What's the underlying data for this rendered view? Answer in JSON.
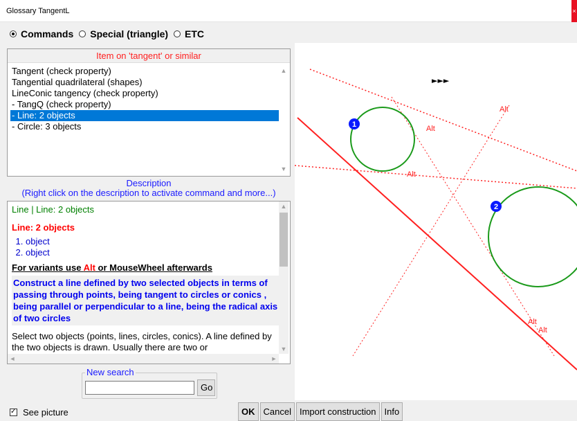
{
  "window": {
    "title": "Glossary  TangentL",
    "close_glyph": "×"
  },
  "modes": [
    {
      "label": "Commands",
      "checked": true
    },
    {
      "label": "Special (triangle)",
      "checked": false
    },
    {
      "label": "ETC",
      "checked": false
    }
  ],
  "items": {
    "header": "Item on 'tangent' or similar",
    "list": [
      "Tangent  (check property)",
      "Tangential quadrilateral  (shapes)",
      "LineConic tangency  (check property)",
      "- TangQ  (check property)",
      "- Line: 2 objects",
      "- Circle: 3 objects"
    ],
    "selected_index": 4
  },
  "description": {
    "header_line1": "Description",
    "header_line2": "(Right click on the description to activate command and more...)",
    "breadcrumb": "Line | Line: 2 objects",
    "title": "Line: 2 objects",
    "params": [
      "object",
      "object"
    ],
    "variants_prefix": "For variants use ",
    "variants_alt": "Alt",
    "variants_suffix": " or MouseWheel afterwards",
    "summary": "Construct a line defined by two selected objects in terms of passing through points, being tangent to circles or conics , being parallel or perpendicular to a line, being the radical axis of two circles",
    "detail": "Select two objects (points, lines, circles, conics). A line defined by the two objects is drawn. Usually there are two or"
  },
  "search": {
    "legend": "New search",
    "value": "",
    "go_label": "Go"
  },
  "footer": {
    "see_picture_label": "See picture",
    "see_picture_checked": true,
    "buttons": [
      "OK",
      "Cancel",
      "Import construction",
      "Info"
    ]
  },
  "picture": {
    "arrows": "►►►",
    "label_1": "1",
    "label_2": "2",
    "alt_label": "Alt",
    "colors": {
      "circle": "#1a9a1a",
      "line": "#ff2020",
      "marker": "#0a1aff"
    }
  },
  "colors": {
    "accent_blue": "#1a1aff",
    "header_red": "#ff2020",
    "selection": "#0078d7"
  }
}
